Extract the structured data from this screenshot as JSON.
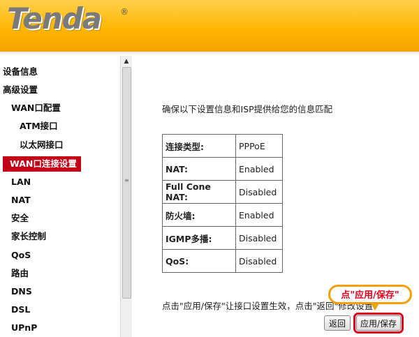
{
  "brand": {
    "logo": "Tenda",
    "reg_mark": "®"
  },
  "sidebar": {
    "items": [
      {
        "label": "设备信息"
      },
      {
        "label": "高级设置"
      },
      {
        "label": "WAN口配置"
      },
      {
        "label": "ATM接口"
      },
      {
        "label": "以太网接口"
      },
      {
        "label": "WAN口连接设置",
        "active": true
      },
      {
        "label": "LAN"
      },
      {
        "label": "NAT"
      },
      {
        "label": "安全"
      },
      {
        "label": "家长控制"
      },
      {
        "label": "QoS"
      },
      {
        "label": "路由"
      },
      {
        "label": "DNS"
      },
      {
        "label": "DSL"
      },
      {
        "label": "UPnP"
      }
    ]
  },
  "main": {
    "intro": "确保以下设置信息和ISP提供给您的信息匹配",
    "rows": [
      {
        "label": "连接类型:",
        "value": "PPPoE"
      },
      {
        "label": "NAT:",
        "value": "Enabled"
      },
      {
        "label": "Full Cone NAT:",
        "value": "Disabled"
      },
      {
        "label": "防火墙:",
        "value": "Enabled"
      },
      {
        "label": "IGMP多播:",
        "value": "Disabled"
      },
      {
        "label": "QoS:",
        "value": "Disabled"
      }
    ],
    "footer_text": "点击\"应用/保存\"让接口设置生效，点击\"返回\"修改设置",
    "back_label": "返回",
    "apply_label": "应用/保存"
  },
  "annotation": {
    "callout": "点\"应用/保存\""
  },
  "colors": {
    "header": "#ffb400",
    "active_menu": "#c30015",
    "highlight": "#e0001a"
  }
}
